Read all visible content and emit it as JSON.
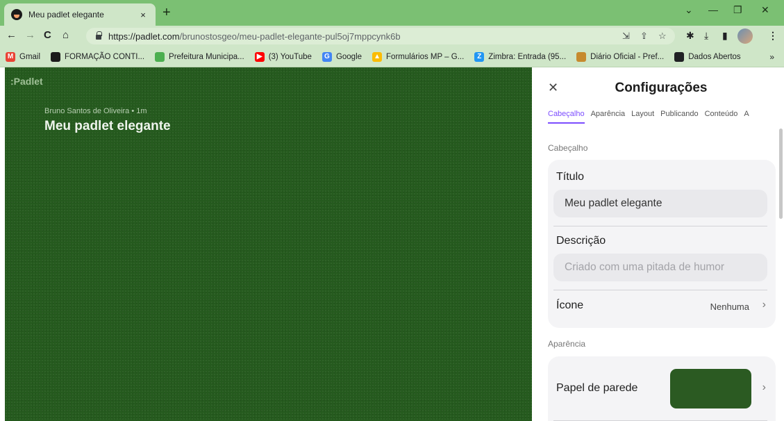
{
  "browser": {
    "tab_title": "Meu padlet elegante",
    "tab_close": "×",
    "new_tab": "+",
    "window_controls": {
      "minimize_glyph": "—",
      "restore_glyph": "❐",
      "close_glyph": "✕",
      "tabsearch_glyph": "⌄"
    },
    "url_host": "https://padlet.com",
    "url_path": "/brunostosgeo/meu-padlet-elegante-pul5oj7mppcynk6b",
    "nav": {
      "back": "←",
      "forward": "→",
      "reload": "C",
      "home": "⌂"
    },
    "bookmarks": [
      {
        "label": "Gmail",
        "icon": "gmail-icon",
        "color": "#ea4335",
        "glyph": "M"
      },
      {
        "label": "FORMAÇÃO CONTI...",
        "icon": "padlet-avatar-icon",
        "color": "#1b1b1b",
        "glyph": ""
      },
      {
        "label": "Prefeitura Municipa...",
        "icon": "coat-of-arms-icon",
        "color": "#4caf50",
        "glyph": ""
      },
      {
        "label": "(3) YouTube",
        "icon": "youtube-icon",
        "color": "#ff0000",
        "glyph": "▶"
      },
      {
        "label": "Google",
        "icon": "google-icon",
        "color": "#4285f4",
        "glyph": "G"
      },
      {
        "label": "Formulários MP – G...",
        "icon": "drive-icon",
        "color": "#fbbc04",
        "glyph": "▲"
      },
      {
        "label": "Zimbra: Entrada (95...",
        "icon": "zimbra-icon",
        "color": "#2196f3",
        "glyph": "Z"
      },
      {
        "label": "Diário Oficial - Pref...",
        "icon": "seal-icon",
        "color": "#c68a2e",
        "glyph": ""
      },
      {
        "label": "Dados Abertos",
        "icon": "book-icon",
        "color": "#202124",
        "glyph": ""
      }
    ],
    "bookmarks_more": "»"
  },
  "board": {
    "logo": ":Padlet",
    "author": "Bruno Santos de Oliveira",
    "separator": "•",
    "time": "1m",
    "title": "Meu padlet elegante",
    "background_color": "#255a1e"
  },
  "settings": {
    "close": "✕",
    "title": "Configurações",
    "tabs": [
      "Cabeçalho",
      "Aparência",
      "Layout",
      "Publicando",
      "Conteúdo",
      "A"
    ],
    "active_tab": "Cabeçalho",
    "accent_color": "#7c4dff",
    "header_section": {
      "label": "Cabeçalho",
      "title_label": "Título",
      "title_value": "Meu padlet elegante",
      "description_label": "Descrição",
      "description_placeholder": "Criado com uma pitada de humor",
      "icon_label": "Ícone",
      "icon_value": "Nenhuma"
    },
    "appearance_section": {
      "label": "Aparência",
      "wallpaper_label": "Papel de parede",
      "wallpaper_color": "#2b5a22"
    }
  }
}
